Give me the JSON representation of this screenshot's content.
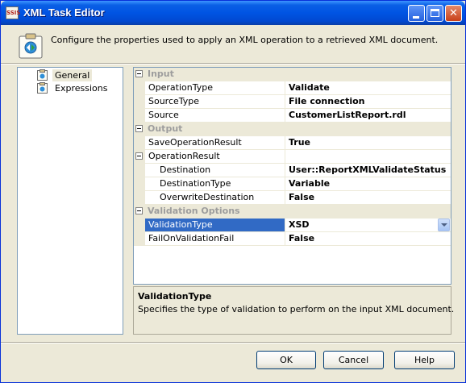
{
  "window": {
    "title": "XML Task Editor",
    "icon_label": "SSIS",
    "close_glyph": "✕"
  },
  "header": {
    "description": "Configure the properties used to apply an XML operation to a retrieved XML document."
  },
  "nav": {
    "items": [
      {
        "label": "General",
        "selected": true
      },
      {
        "label": "Expressions",
        "selected": false
      }
    ]
  },
  "grid": {
    "rows": [
      {
        "kind": "category",
        "name": "Input"
      },
      {
        "kind": "prop",
        "name": "OperationType",
        "value": "Validate"
      },
      {
        "kind": "prop",
        "name": "SourceType",
        "value": "File connection"
      },
      {
        "kind": "prop",
        "name": "Source",
        "value": "CustomerListReport.rdl"
      },
      {
        "kind": "category",
        "name": "Output"
      },
      {
        "kind": "prop",
        "name": "SaveOperationResult",
        "value": "True"
      },
      {
        "kind": "group",
        "name": "OperationResult",
        "value": ""
      },
      {
        "kind": "sub",
        "name": "Destination",
        "value": "User::ReportXMLValidateStatus"
      },
      {
        "kind": "sub",
        "name": "DestinationType",
        "value": "Variable"
      },
      {
        "kind": "sub",
        "name": "OverwriteDestination",
        "value": "False"
      },
      {
        "kind": "category",
        "name": "Validation Options"
      },
      {
        "kind": "prop",
        "name": "ValidationType",
        "value": "XSD",
        "selected": true
      },
      {
        "kind": "prop",
        "name": "FailOnValidationFail",
        "value": "False"
      }
    ]
  },
  "description_panel": {
    "title": "ValidationType",
    "text": "Specifies the type of validation to perform on the input XML document."
  },
  "buttons": {
    "ok": "OK",
    "cancel": "Cancel",
    "help": "Help"
  },
  "colors": {
    "titlebar": "#0054e3",
    "selection": "#316ac5",
    "dialog_bg": "#ece9d8"
  }
}
